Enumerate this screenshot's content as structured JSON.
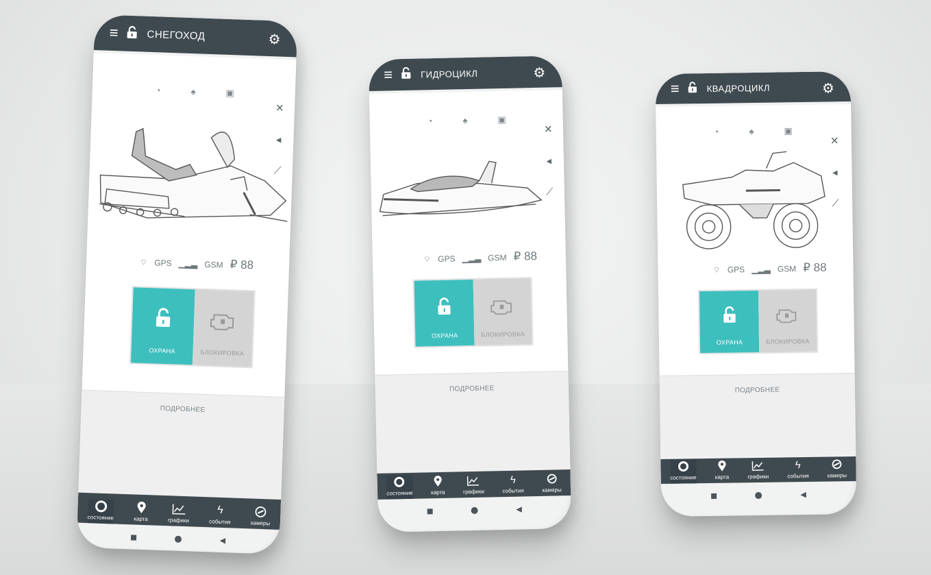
{
  "phones": [
    {
      "title": "СНЕГОХОД",
      "stats": {
        "gps": "GPS",
        "gsm": "GSM",
        "balance": "₽ 88"
      },
      "controls": {
        "guard": "ОХРАНА",
        "block": "БЛОКИРОВКА"
      },
      "more": "ПОДРОБНЕЕ",
      "nav": [
        "состояние",
        "карта",
        "графики",
        "события",
        "камеры"
      ]
    },
    {
      "title": "ГИДРОЦИКЛ",
      "stats": {
        "gps": "GPS",
        "gsm": "GSM",
        "balance": "₽ 88"
      },
      "controls": {
        "guard": "ОХРАНА",
        "block": "БЛОКИРОВКА"
      },
      "more": "ПОДРОБНЕЕ",
      "nav": [
        "состояние",
        "карта",
        "графики",
        "события",
        "камеры"
      ]
    },
    {
      "title": "КВАДРОЦИКЛ",
      "stats": {
        "gps": "GPS",
        "gsm": "GSM",
        "balance": "₽ 88"
      },
      "controls": {
        "guard": "ОХРАНА",
        "block": "БЛОКИРОВКА"
      },
      "more": "ПОДРОБНЕЕ",
      "nav": [
        "состояние",
        "карта",
        "графики",
        "события",
        "камеры"
      ]
    }
  ],
  "colors": {
    "topbar": "#3f4a50",
    "accent": "#3dbfbe",
    "inactive": "#d4d4d4"
  },
  "icons": [
    "menu-icon",
    "lock-icon",
    "gear-icon",
    "speedometer-icon",
    "oil-icon",
    "battery-icon",
    "tools-icon",
    "speaker-icon",
    "syringe-icon",
    "wifi-icon",
    "signal-icon",
    "engine-icon",
    "location-pin-icon",
    "chart-icon",
    "lightning-icon",
    "camera-icon"
  ]
}
